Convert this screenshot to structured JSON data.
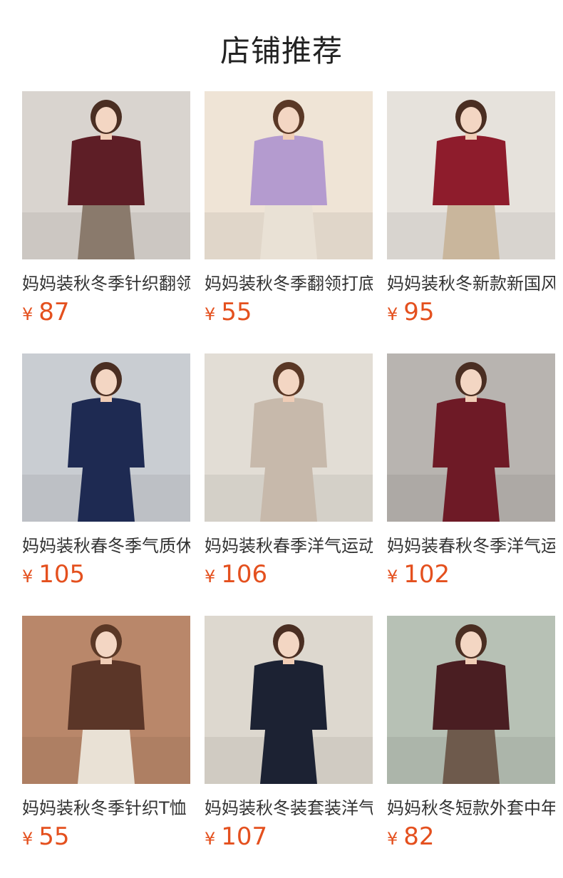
{
  "header": {
    "title": "店铺推荐"
  },
  "products": [
    {
      "name": "妈妈装秋冬季针织翻领",
      "currency": "¥",
      "price": "87",
      "colors": {
        "bg": "#d9d4cf",
        "top": "#5e1e26",
        "bottom": "#8a7a6c",
        "hair": "#4a2e22"
      }
    },
    {
      "name": "妈妈装秋冬季翻领打底",
      "currency": "¥",
      "price": "55",
      "colors": {
        "bg": "#efe4d6",
        "top": "#b49bcf",
        "bottom": "#e9e1d5",
        "hair": "#5a3826"
      }
    },
    {
      "name": "妈妈装秋冬新款新国风",
      "currency": "¥",
      "price": "95",
      "colors": {
        "bg": "#e6e2dc",
        "top": "#8e1c2c",
        "bottom": "#c9b69c",
        "hair": "#4a2e22"
      }
    },
    {
      "name": "妈妈装秋春冬季气质休",
      "currency": "¥",
      "price": "105",
      "colors": {
        "bg": "#c9cdd2",
        "top": "#1e2a52",
        "bottom": "#1e2a52",
        "hair": "#4a2e22"
      }
    },
    {
      "name": "妈妈装秋春季洋气运动",
      "currency": "¥",
      "price": "106",
      "colors": {
        "bg": "#e2ddd5",
        "top": "#c7b9ab",
        "bottom": "#c7b9ab",
        "hair": "#5a3826"
      }
    },
    {
      "name": "妈妈装春秋冬季洋气运",
      "currency": "¥",
      "price": "102",
      "colors": {
        "bg": "#b8b4b0",
        "top": "#6e1a26",
        "bottom": "#6e1a26",
        "hair": "#4a2e22"
      }
    },
    {
      "name": "妈妈装秋冬季针织T恤",
      "currency": "¥",
      "price": "55",
      "colors": {
        "bg": "#b9876a",
        "top": "#5b3628",
        "bottom": "#e9e1d5",
        "hair": "#5a3826"
      }
    },
    {
      "name": "妈妈装秋冬装套装洋气",
      "currency": "¥",
      "price": "107",
      "colors": {
        "bg": "#ddd8cf",
        "top": "#1c2233",
        "bottom": "#1c2233",
        "hair": "#4a2e22"
      }
    },
    {
      "name": "妈妈秋冬短款外套中年",
      "currency": "¥",
      "price": "82",
      "colors": {
        "bg": "#b7c1b5",
        "top": "#4a1e22",
        "bottom": "#6e5a4c",
        "hair": "#4a2e22"
      }
    }
  ]
}
